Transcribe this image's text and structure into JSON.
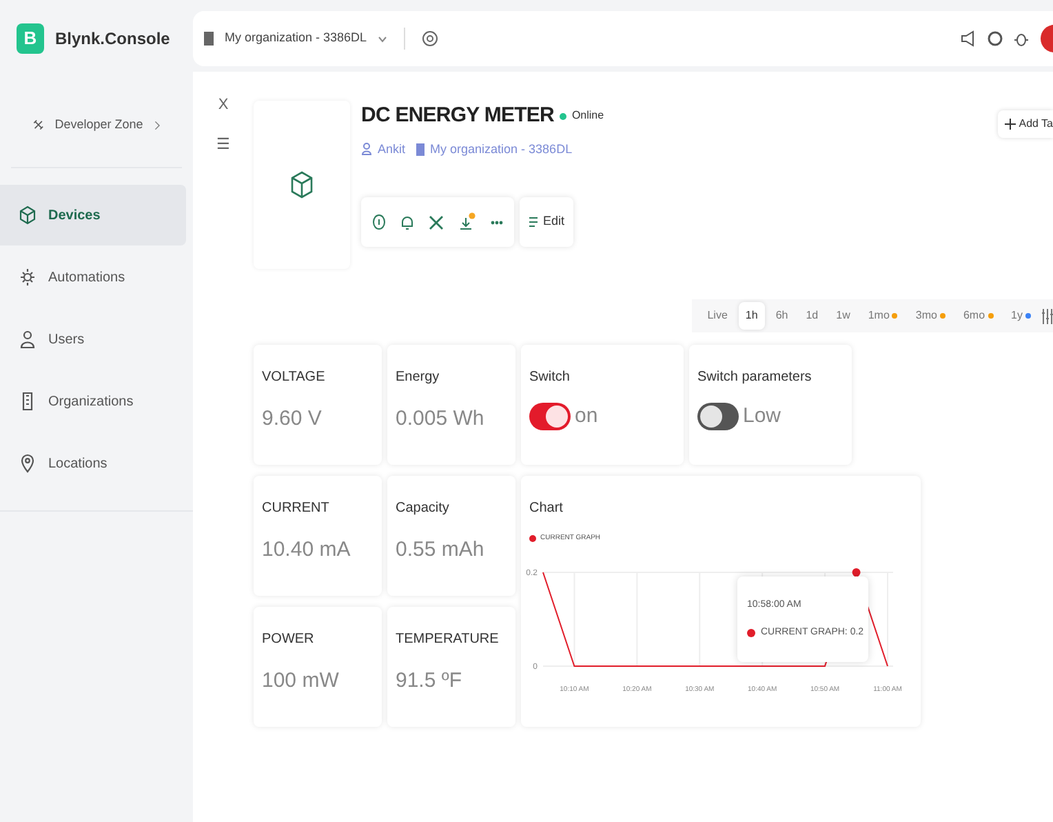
{
  "brand": {
    "logo_letter": "B",
    "name": "Blynk.Console"
  },
  "header": {
    "organization": "My organization - 3386DL",
    "add_button": "Add Ta"
  },
  "sidebar": {
    "developer_zone": "Developer Zone",
    "items": [
      {
        "label": "Devices",
        "selected": true
      },
      {
        "label": "Automations",
        "selected": false
      },
      {
        "label": "Users",
        "selected": false
      },
      {
        "label": "Organizations",
        "selected": false
      },
      {
        "label": "Locations",
        "selected": false
      }
    ]
  },
  "panel_controls": {
    "close": "X",
    "menu": "☰"
  },
  "device": {
    "title": "DC ENERGY METER",
    "status": "Online",
    "online": true,
    "owner": "Ankit",
    "organization": "My organization - 3386DL",
    "edit_label": "Edit"
  },
  "time_ranges": [
    {
      "label": "Live",
      "selected": false
    },
    {
      "label": "1h",
      "selected": true
    },
    {
      "label": "6h",
      "selected": false
    },
    {
      "label": "1d",
      "selected": false
    },
    {
      "label": "1w",
      "selected": false
    },
    {
      "label": "1mo",
      "selected": false,
      "color": "#f59e0b"
    },
    {
      "label": "3mo",
      "selected": false,
      "color": "#f59e0b"
    },
    {
      "label": "6mo",
      "selected": false,
      "color": "#f59e0b"
    },
    {
      "label": "1y",
      "selected": false,
      "color": "#3b82f6"
    }
  ],
  "widgets": [
    {
      "kind": "value",
      "title": "VOLTAGE",
      "value": "9.60 V"
    },
    {
      "kind": "value",
      "title": "Energy",
      "value": "0.005 Wh"
    },
    {
      "kind": "switch",
      "title": "Switch",
      "on": true,
      "value": "on"
    },
    {
      "kind": "switch",
      "title": "Switch parameters",
      "on": false,
      "value": "Low"
    },
    {
      "kind": "value",
      "title": "CURRENT",
      "value": "10.40 mA"
    },
    {
      "kind": "value",
      "title": "Capacity",
      "value": "0.55 mAh"
    },
    {
      "kind": "chart",
      "title": "Chart",
      "tooltip_time": "10:58:00 AM",
      "tooltip_label": "CURRENT GRAPH: 0.2",
      "chart_data": {
        "type": "line",
        "categories": [
          null,
          "10:10 AM",
          null,
          "10:20 AM",
          null,
          "10:30 AM",
          null,
          "10:40 AM",
          null,
          "10:50 AM",
          null,
          "11:00 AM"
        ],
        "series": [
          {
            "name": "CURRENT GRAPH",
            "color": "#e11d2a",
            "values": [
              0.2,
              0,
              0,
              0,
              0,
              0,
              0,
              0,
              0,
              0,
              0.2,
              0
            ]
          }
        ],
        "ylim": [
          0,
          0.2
        ],
        "yticks": [
          0,
          0.2
        ],
        "grid": true
      }
    },
    {
      "kind": "value",
      "title": "POWER",
      "value": "100 mW"
    },
    {
      "kind": "value",
      "title": "TEMPERATURE",
      "value": "91.5 ºF"
    }
  ]
}
